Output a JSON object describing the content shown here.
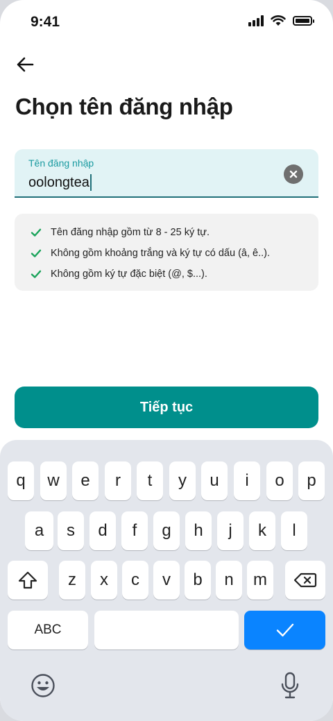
{
  "status_bar": {
    "time": "9:41"
  },
  "page": {
    "title": "Chọn tên đăng nhập"
  },
  "username_field": {
    "label": "Tên đăng nhập",
    "value": "oolongtea"
  },
  "rules": [
    "Tên đăng nhập gồm từ 8 - 25 ký tự.",
    "Không gồm khoảng trắng và ký tự có dấu (â, ê..).",
    "Không gồm ký tự đặc biệt (@, $...)."
  ],
  "continue_button": {
    "label": "Tiếp tục"
  },
  "keyboard": {
    "row1": [
      "q",
      "w",
      "e",
      "r",
      "t",
      "y",
      "u",
      "i",
      "o",
      "p"
    ],
    "row2": [
      "a",
      "s",
      "d",
      "f",
      "g",
      "h",
      "j",
      "k",
      "l"
    ],
    "row3": [
      "z",
      "x",
      "c",
      "v",
      "b",
      "n",
      "m"
    ],
    "abc_label": "ABC"
  },
  "colors": {
    "accent": "#008f8c",
    "field_bg": "#e1f3f5",
    "check": "#1aa35a",
    "done_key": "#0a84ff"
  },
  "icons": [
    "back-arrow-icon",
    "clear-icon",
    "check-icon",
    "shift-icon",
    "backspace-icon",
    "checkmark-icon",
    "emoji-icon",
    "microphone-icon"
  ]
}
